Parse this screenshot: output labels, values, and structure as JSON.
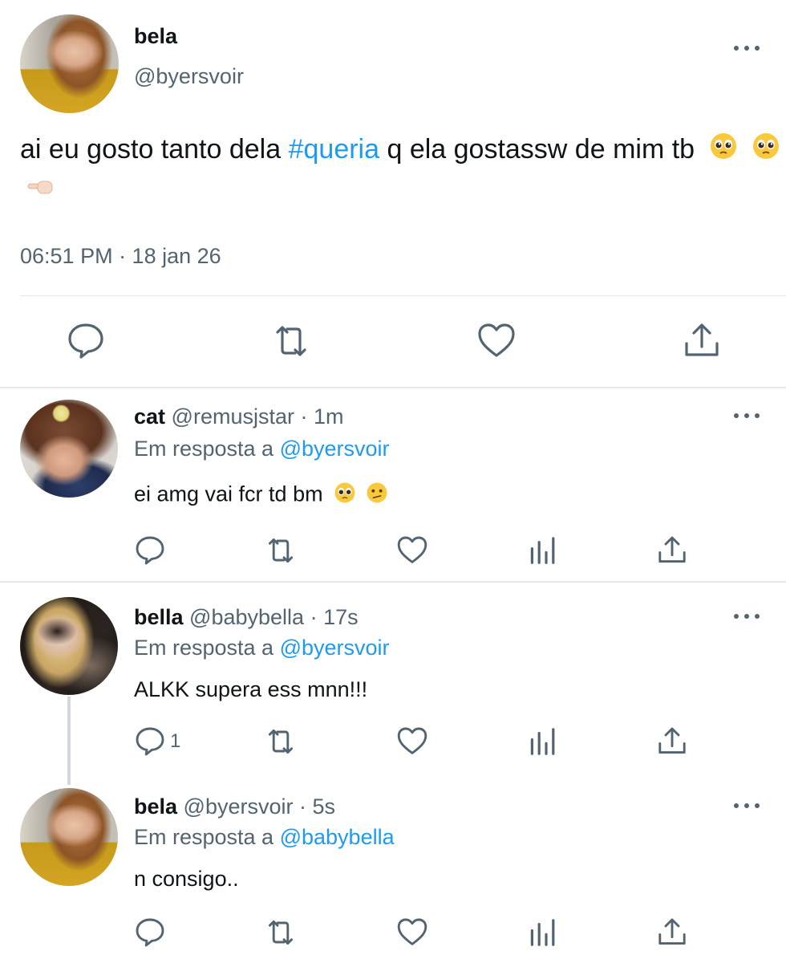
{
  "main_tweet": {
    "author_name": "bela",
    "author_handle": "@byersvoir",
    "text_before_tag": "ai eu gosto tanto dela ",
    "hashtag": "#queria",
    "text_after_tag": " q ela gostassw de mim tb",
    "emojis": [
      "pleading-face",
      "pleading-face",
      "pointing-left-hand"
    ],
    "timestamp": "06:51 PM · 18 jan 26",
    "actions": [
      "reply-icon",
      "retweet-icon",
      "like-icon",
      "share-icon"
    ]
  },
  "replies": [
    {
      "author_name": "cat",
      "author_handle": "@remusjstar",
      "time": "· 1m",
      "reply_prefix": "Em resposta a",
      "reply_to": "@byersvoir",
      "text": "ei amg vai fcr td bm",
      "emojis": [
        "pleading-face",
        "confused-face"
      ],
      "reply_count": ""
    },
    {
      "author_name": "bella",
      "author_handle": "@babybella",
      "time": "· 17s",
      "reply_prefix": "Em resposta a",
      "reply_to": "@byersvoir",
      "text": "ALKK supera ess mnn!!!",
      "emojis": [],
      "reply_count": "1"
    },
    {
      "author_name": "bela",
      "author_handle": "@byersvoir",
      "time": "· 5s",
      "reply_prefix": "Em resposta a",
      "reply_to": "@babybella",
      "text": "n consigo..",
      "emojis": [],
      "reply_count": ""
    }
  ],
  "colors": {
    "link": "#1d9bf0",
    "muted": "#536471",
    "text": "#0f1419",
    "divider": "#e7e9ea"
  }
}
